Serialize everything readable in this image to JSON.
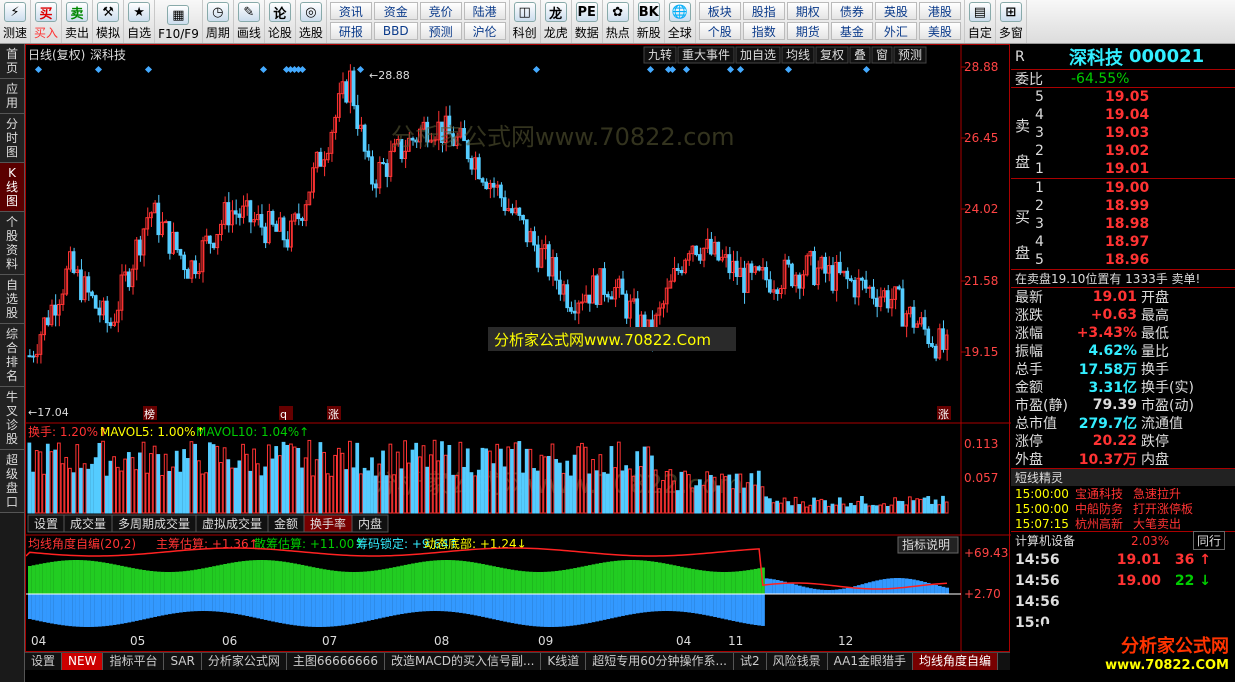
{
  "toolbar": {
    "buttons": [
      {
        "icon": "买",
        "label": "买入",
        "cls": "red"
      },
      {
        "icon": "卖",
        "label": "卖出",
        "cls": "green"
      },
      {
        "icon": "⚒",
        "label": "模拟"
      },
      {
        "icon": "★",
        "label": "自选"
      },
      {
        "icon": "▦",
        "label": "F10/F9"
      },
      {
        "icon": "◷",
        "label": "周期"
      },
      {
        "icon": "✎",
        "label": "画线"
      },
      {
        "icon": "论",
        "label": "论股"
      },
      {
        "icon": "◎",
        "label": "选股"
      }
    ],
    "grid1": [
      "资讯",
      "研报",
      "资金",
      "BBD",
      "竞价",
      "预测",
      "陆港",
      "沪伦"
    ],
    "buttons2": [
      {
        "icon": "◫",
        "label": "科创"
      },
      {
        "icon": "龙",
        "label": "龙虎"
      },
      {
        "icon": "PE",
        "label": "数据"
      },
      {
        "icon": "✿",
        "label": "热点"
      },
      {
        "icon": "BK",
        "label": "新股"
      },
      {
        "icon": "🌐",
        "label": "全球"
      }
    ],
    "grid2": [
      "板块",
      "个股",
      "股指",
      "指数",
      "期权",
      "期货",
      "债券",
      "基金",
      "英股",
      "外汇",
      "港股",
      "美股"
    ],
    "buttons3": [
      {
        "icon": "▤",
        "label": "自定"
      },
      {
        "icon": "⊞",
        "label": "多窗"
      }
    ],
    "left_label": "测速"
  },
  "sidebar": [
    "首页",
    "应用",
    "分时图",
    "K线图",
    "个股资料",
    "自选股",
    "综合排名",
    "牛叉诊股",
    "超级盘口"
  ],
  "chart": {
    "title": "日线(复权)",
    "name": "深科技",
    "tools": [
      "九转",
      "重大事件",
      "加自选",
      "均线",
      "复权",
      "叠",
      "窗",
      "预测"
    ],
    "high_label": "28.88",
    "low_label": "17.04",
    "price_ticks": [
      "28.88",
      "26.45",
      "24.02",
      "21.58",
      "19.15"
    ],
    "vol_legend": {
      "a": "换手: 1.20%↑",
      "b": "MAVOL5: 1.00%↑",
      "c": "MAVOL10: 1.04%↑"
    },
    "vol_ticks": [
      "0.113",
      "0.057"
    ],
    "vol_tabs": [
      "设置",
      "成交量",
      "多周期成交量",
      "虚拟成交量",
      "金额",
      "换手率",
      "内盘"
    ],
    "ind_legend": {
      "a": "均线角度自编(20,2)",
      "b": "主筹估算: +1.36↑",
      "c": "散筹估算: +11.00↑",
      "d": "筹码锁定: +9.64↑",
      "e": "动态底部: +1.24↓"
    },
    "ind_help": "指标说明",
    "ind_ticks": [
      "+69.43",
      "+2.70"
    ],
    "months": [
      "04",
      "05",
      "06",
      "07",
      "08",
      "09",
      "04",
      "11",
      "12"
    ],
    "markers": [
      "榜",
      "q",
      "涨",
      "涨"
    ],
    "watermark1": "分析家公式网www.70822.com",
    "watermark2": "分析家公式网www.70822.Com",
    "watermark3": "分析家公式网www.70822.com"
  },
  "bottom_tabs": [
    "设置",
    "NEW",
    "指标平台",
    "SAR",
    "分析家公式网",
    "主图66666666",
    "改造MACD的买入信号副...",
    "K线道",
    "超短专用60分钟操作系...",
    "试2",
    "风险钱景",
    "AA1金眼猎手",
    "均线角度自编"
  ],
  "quote": {
    "r": "R",
    "name": "深科技",
    "code": "000021",
    "weibi_label": "委比",
    "weibi": "-64.55%",
    "sell_label": "卖盘",
    "buy_label": "买盘",
    "sells": [
      {
        "n": "5",
        "p": "19.05"
      },
      {
        "n": "4",
        "p": "19.04"
      },
      {
        "n": "3",
        "p": "19.03"
      },
      {
        "n": "2",
        "p": "19.02"
      },
      {
        "n": "1",
        "p": "19.01"
      }
    ],
    "buys": [
      {
        "n": "1",
        "p": "19.00"
      },
      {
        "n": "2",
        "p": "18.99"
      },
      {
        "n": "3",
        "p": "18.98"
      },
      {
        "n": "4",
        "p": "18.97"
      },
      {
        "n": "5",
        "p": "18.96"
      }
    ],
    "notice": "在卖盘19.10位置有 1333手 卖单!",
    "stats": [
      {
        "l": "最新",
        "v": "19.01",
        "c": "red",
        "r": "开盘"
      },
      {
        "l": "涨跌",
        "v": "+0.63",
        "c": "red",
        "r": "最高"
      },
      {
        "l": "涨幅",
        "v": "+3.43%",
        "c": "red",
        "r": "最低"
      },
      {
        "l": "振幅",
        "v": "4.62%",
        "c": "cyan",
        "r": "量比"
      },
      {
        "l": "总手",
        "v": "17.58万",
        "c": "cyan",
        "r": "换手"
      },
      {
        "l": "金额",
        "v": "3.31亿",
        "c": "cyan",
        "r": "换手(实)"
      },
      {
        "l": "市盈(静)",
        "v": "79.39",
        "c": "wht",
        "r": "市盈(动)"
      },
      {
        "l": "总市值",
        "v": "279.7亿",
        "c": "cyan",
        "r": "流通值"
      },
      {
        "l": "涨停",
        "v": "20.22",
        "c": "red",
        "r": "跌停"
      },
      {
        "l": "外盘",
        "v": "10.37万",
        "c": "red",
        "r": "内盘"
      }
    ],
    "jl_title": "短线精灵",
    "jl": [
      {
        "t": "15:00:00",
        "s": "宝通科技",
        "e": "急速拉升"
      },
      {
        "t": "15:00:00",
        "s": "中船防务",
        "e": "打开涨停板"
      },
      {
        "t": "15:07:15",
        "s": "杭州高新",
        "e": "大笔卖出"
      }
    ],
    "ind_row": {
      "name": "计算机设备",
      "pct": "2.03%",
      "btn": "同行"
    },
    "ticks": [
      {
        "t": "14:56",
        "p": "19.01",
        "v": "36",
        "d": "↑"
      },
      {
        "t": "14:56",
        "p": "19.00",
        "v": "22",
        "d": "↓"
      },
      {
        "t": "14:56",
        "p": "",
        "v": "",
        "d": ""
      },
      {
        "t": "15:0",
        "p": "",
        "v": "",
        "d": ""
      }
    ],
    "logo": "分析家公式网",
    "logo_url": "www.70822.COM"
  }
}
